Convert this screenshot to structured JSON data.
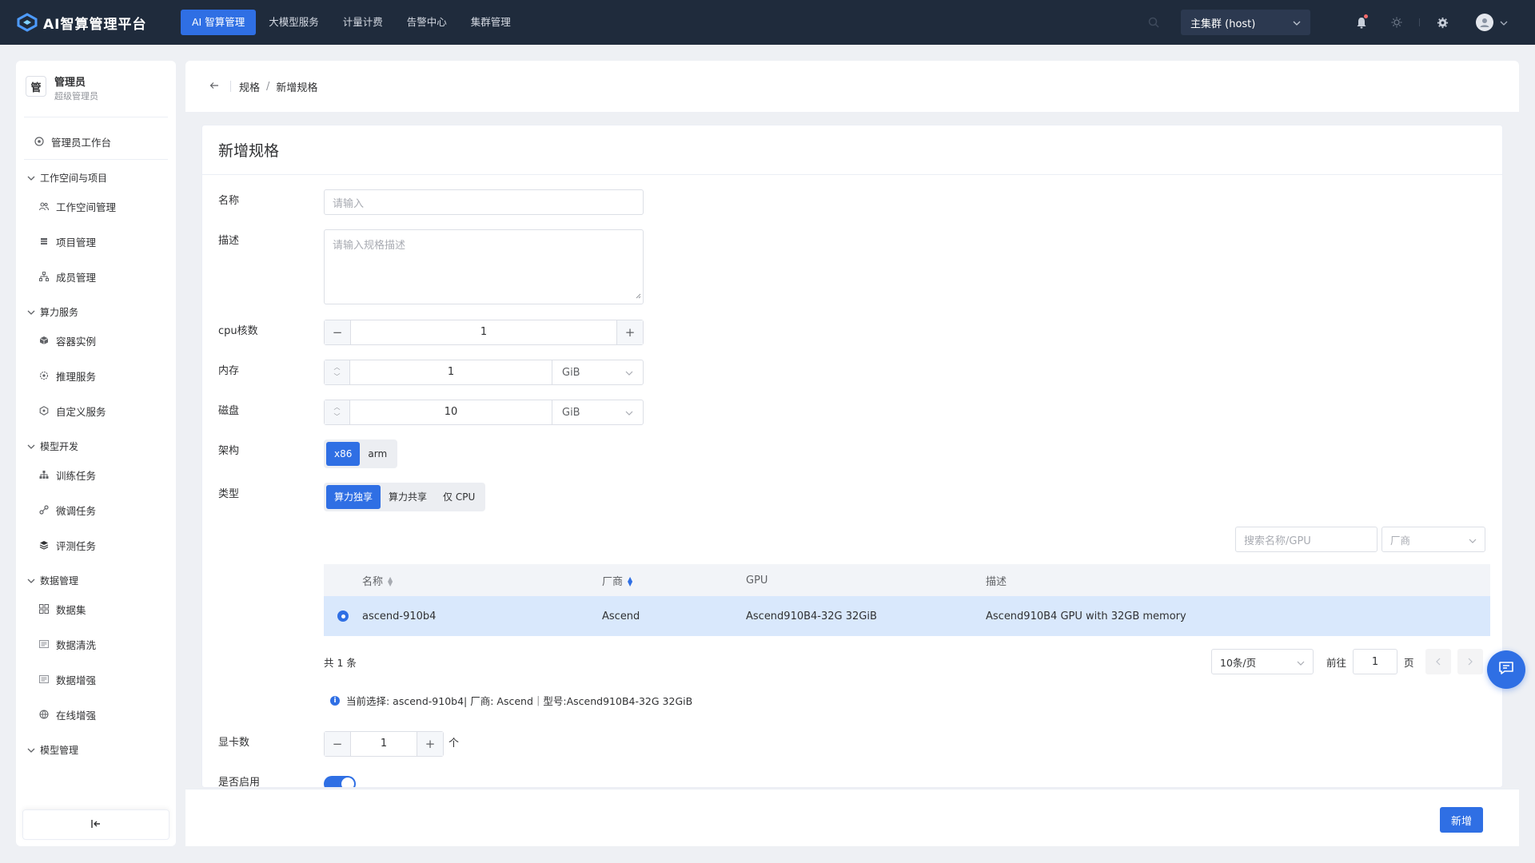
{
  "app": {
    "brand": "AI智算管理平台"
  },
  "topnav": [
    {
      "label": "AI 智算管理",
      "active": true
    },
    {
      "label": "大模型服务",
      "active": false
    },
    {
      "label": "计量计费",
      "active": false
    },
    {
      "label": "告警中心",
      "active": false
    },
    {
      "label": "集群管理",
      "active": false
    }
  ],
  "cluster": {
    "label": "主集群 (host)"
  },
  "user": {
    "avatar_char": "管",
    "name": "管理员",
    "role": "超级管理员"
  },
  "sidebar": {
    "workbench": "管理员工作台",
    "groups": [
      {
        "label": "工作空间与项目",
        "items": [
          "工作空间管理",
          "项目管理",
          "成员管理"
        ]
      },
      {
        "label": "算力服务",
        "items": [
          "容器实例",
          "推理服务",
          "自定义服务"
        ]
      },
      {
        "label": "模型开发",
        "items": [
          "训练任务",
          "微调任务",
          "评测任务"
        ]
      },
      {
        "label": "数据管理",
        "items": [
          "数据集",
          "数据清洗",
          "数据增强",
          "在线增强"
        ]
      },
      {
        "label": "模型管理",
        "items": []
      }
    ],
    "collapse_icon": "collapse-left-icon"
  },
  "breadcrumb": {
    "root": "规格",
    "sep": "/",
    "current": "新增规格"
  },
  "form": {
    "title": "新增规格",
    "name": {
      "label": "名称",
      "placeholder": "请输入"
    },
    "desc": {
      "label": "描述",
      "placeholder": "请输入规格描述"
    },
    "cpu": {
      "label": "cpu核数",
      "value": "1",
      "minus": "−",
      "plus": "+"
    },
    "memory": {
      "label": "内存",
      "value": "1",
      "unit": "GiB"
    },
    "disk": {
      "label": "磁盘",
      "value": "10",
      "unit": "GiB"
    },
    "arch": {
      "label": "架构",
      "options": [
        "x86",
        "arm"
      ],
      "selected": "x86"
    },
    "type": {
      "label": "类型",
      "options": [
        "算力独享",
        "算力共享",
        "仅 CPU"
      ],
      "selected": "算力独享"
    },
    "gpu_search": {
      "placeholder": "搜索名称/GPU",
      "vendor_placeholder": "厂商"
    },
    "gpu_table": {
      "headers": [
        "名称",
        "厂商",
        "GPU",
        "描述"
      ],
      "rows": [
        {
          "name": "ascend-910b4",
          "vendor": "Ascend",
          "gpu": "Ascend910B4-32G 32GiB",
          "desc": "Ascend910B4 GPU with 32GB memory",
          "selected": true
        }
      ]
    },
    "pagination": {
      "total": "共 1 条",
      "page_size": "10条/页",
      "goto": "前往",
      "page": "1",
      "page_unit": "页"
    },
    "selection_info": "当前选择: ascend-910b4| 厂商: Ascend｜型号:Ascend910B4-32G 32GiB",
    "gpu_count": {
      "label": "显卡数",
      "value": "1",
      "unit": "个"
    },
    "enabled": {
      "label": "是否启用",
      "value": true
    }
  },
  "footer": {
    "submit": "新增"
  },
  "colors": {
    "accent": "#2f6fe4",
    "topbar": "#1f2b3c",
    "selected_row": "#d9e8fc"
  }
}
